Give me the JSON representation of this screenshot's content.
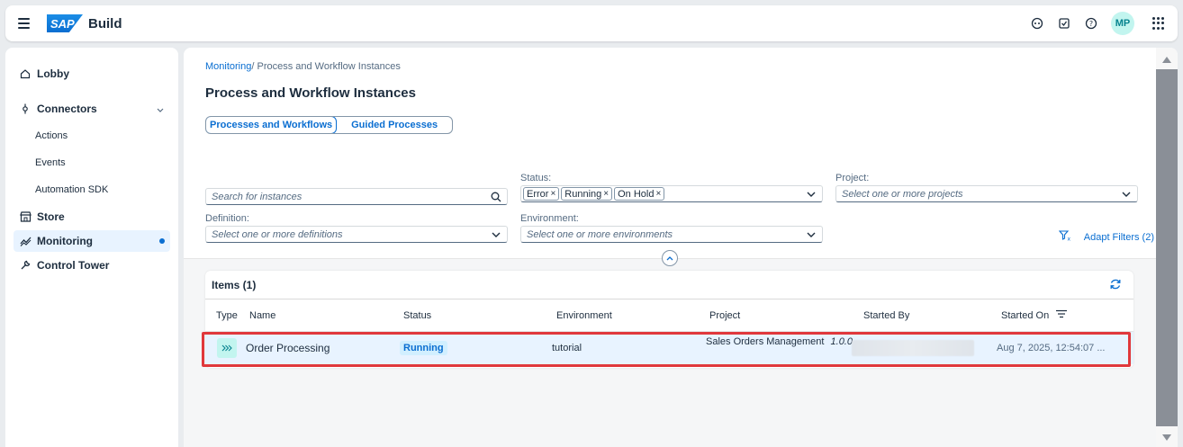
{
  "shell": {
    "logo_text": "SAP",
    "product_name": "Build",
    "avatar_initials": "MP"
  },
  "sidebar": {
    "items": [
      {
        "label": "Lobby"
      },
      {
        "label": "Connectors"
      },
      {
        "label": "Actions"
      },
      {
        "label": "Events"
      },
      {
        "label": "Automation SDK"
      },
      {
        "label": "Store"
      },
      {
        "label": "Monitoring"
      },
      {
        "label": "Control Tower"
      }
    ]
  },
  "breadcrumb": {
    "link": "Monitoring",
    "separator": "/",
    "current": "Process and Workflow Instances"
  },
  "page": {
    "title": "Process and Workflow Instances"
  },
  "segmented": {
    "option1": "Processes and Workflows",
    "option2": "Guided Processes"
  },
  "filters": {
    "search_placeholder": "Search for instances",
    "status_label": "Status:",
    "status_tokens": [
      "Error",
      "Running",
      "On Hold"
    ],
    "project_label": "Project:",
    "project_placeholder": "Select one or more projects",
    "definition_label": "Definition:",
    "definition_placeholder": "Select one or more definitions",
    "environment_label": "Environment:",
    "environment_placeholder": "Select one or more environments",
    "adapt_filters": "Adapt Filters (2)"
  },
  "table": {
    "title": "Items (1)",
    "columns": [
      "Type",
      "Name",
      "Status",
      "Environment",
      "Project",
      "Started By",
      "Started On"
    ],
    "rows": [
      {
        "type_icon": "chevrons-right-icon",
        "name": "Order Processing",
        "status": "Running",
        "environment": "tutorial",
        "project": "Sales Orders Management",
        "version": "1.0.0",
        "started_on": "Aug 7, 2025, 12:54:07 ..."
      }
    ]
  },
  "colors": {
    "accent": "#0a6ed1",
    "highlight": "#e0383c",
    "avatar_bg": "#c2f5ef"
  }
}
